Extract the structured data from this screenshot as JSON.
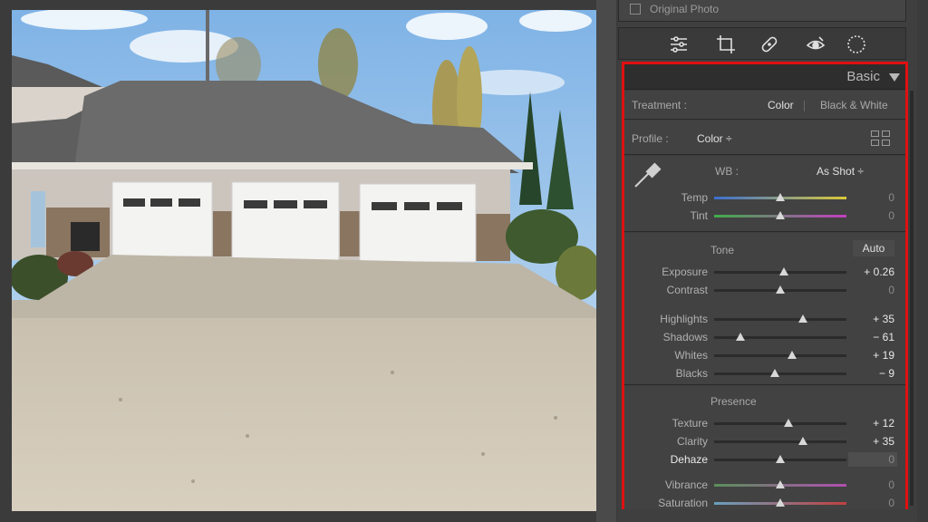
{
  "options": {
    "original_photo_label": "Original Photo"
  },
  "toolstrip": [
    "sliders-icon",
    "crop-icon",
    "healing-icon",
    "redeye-icon",
    "mask-icon"
  ],
  "basic": {
    "title": "Basic",
    "treatment": {
      "label": "Treatment :",
      "color": "Color",
      "bw": "Black & White"
    },
    "profile": {
      "label": "Profile :",
      "value": "Color ÷"
    },
    "wb": {
      "label": "WB :",
      "value": "As Shot ÷"
    },
    "wb_sliders": [
      {
        "label": "Temp",
        "value": "0",
        "level": 0.5,
        "colors": [
          "#3c6fd0",
          "#d9c93a"
        ]
      },
      {
        "label": "Tint",
        "value": "0",
        "level": 0.5,
        "colors": [
          "#3fae4a",
          "#c13fbf"
        ]
      }
    ],
    "tone": {
      "label": "Tone",
      "auto": "Auto"
    },
    "tone_sliders_a": [
      {
        "label": "Exposure",
        "value": "+ 0.26",
        "level": 0.53
      },
      {
        "label": "Contrast",
        "value": "0",
        "level": 0.5
      }
    ],
    "tone_sliders_b": [
      {
        "label": "Highlights",
        "value": "+ 35",
        "level": 0.67
      },
      {
        "label": "Shadows",
        "value": "− 61",
        "level": 0.2
      },
      {
        "label": "Whites",
        "value": "+ 19",
        "level": 0.59
      },
      {
        "label": "Blacks",
        "value": "− 9",
        "level": 0.46
      }
    ],
    "presence": {
      "label": "Presence"
    },
    "presence_sliders_a": [
      {
        "label": "Texture",
        "value": "+ 12",
        "level": 0.56
      },
      {
        "label": "Clarity",
        "value": "+ 35",
        "level": 0.67
      },
      {
        "label": "Dehaze",
        "value": "0",
        "level": 0.5
      }
    ],
    "presence_sliders_b": [
      {
        "label": "Vibrance",
        "value": "0",
        "level": 0.5,
        "colors": [
          "#5a8f5a",
          "#b04fb0"
        ]
      },
      {
        "label": "Saturation",
        "value": "0",
        "level": 0.5,
        "colors": [
          "#6aa0c0",
          "#c04040"
        ]
      }
    ]
  },
  "colors": {
    "highlight_border": "#e01010",
    "panel_bg": "#3d3d3d"
  }
}
